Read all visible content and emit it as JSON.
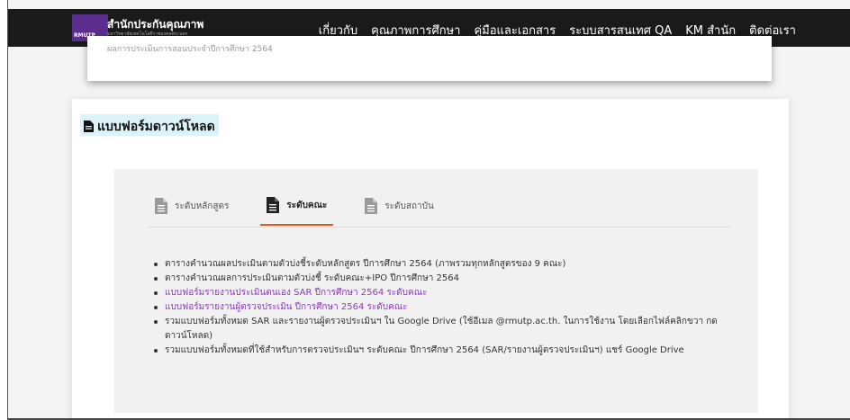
{
  "nav": {
    "logo_text": "RMUTP",
    "title": "สำนักประกันคุณภาพ",
    "subtitle": "มหาวิทยาลัยเทคโนโลยีราชมงคลพระนคร",
    "links": [
      "เกี่ยวกับ",
      "คุณภาพการศึกษา",
      "คู่มือและเอกสาร",
      "ระบบสารสนเทศ QA",
      "KM สำนัก",
      "ติดต่อเรา"
    ]
  },
  "upper_card": {
    "text": "ผลการประเมินการสอนประจำปีการศึกษา 2564"
  },
  "section": {
    "title": "แบบฟอร์มดาวน์โหลด"
  },
  "tabs": [
    {
      "label": "ระดับหลักสูตร",
      "icon": "document-icon",
      "active": false
    },
    {
      "label": "ระดับคณะ",
      "icon": "document-icon",
      "active": true
    },
    {
      "label": "ระดับสถาบัน",
      "icon": "document-icon",
      "active": false
    }
  ],
  "items": [
    {
      "text": "ตารางคำนวณผลประเมินตามตัวบ่งชี้ระดับหลักสูตร ปีการศึกษา 2564 (ภาพรวมทุกหลักสูตรของ 9 คณะ)",
      "link": false
    },
    {
      "text": "ตารางคำนวณผลการประเมินตามตัวบ่งชี้ ระดับคณะ+IPO ปีการศึกษา 2564",
      "link": false
    },
    {
      "text": "แบบฟอร์มรายงานประเมินตนเอง SAR ปีการศึกษา 2564  ระดับคณะ",
      "link": true
    },
    {
      "text": "แบบฟอร์มรายงานผู้ตรวจประเมิน ปีการศึกษา 2564 ระดับคณะ",
      "link": true
    },
    {
      "text": "รวมแบบฟอร์มทั้งหมด SAR และรายงานผู้ตรวจประเมินฯ ใน Google Drive (ใช้อีเมล @rmutp.ac.th. ในการใช้งาน โดยเลือกไฟล์คลิกขวา กดดาวน์โหลด)",
      "link": false
    },
    {
      "text": "รวมแบบฟอร์มทั้งหมดที่ใช้สำหรับการตรวจประเมินฯ ระดับคณะ ปีการศึกษา 2564 (SAR/รายงานผู้ตรวจประเมินฯ) แชร์ Google Drive",
      "link": false
    }
  ],
  "colors": {
    "nav_bg": "#1a1a1a",
    "logo_bg": "#5b2d8e",
    "section_highlight": "#dcf3fa",
    "tab_active_underline": "#e05a2b",
    "link": "#8a3ab9"
  }
}
